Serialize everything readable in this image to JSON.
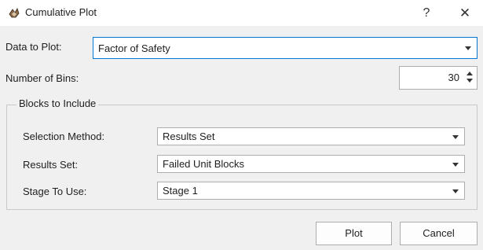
{
  "window": {
    "title": "Cumulative Plot",
    "help_label": "?",
    "close_label": "✕"
  },
  "data_to_plot": {
    "label": "Data to Plot:",
    "value": "Factor of Safety"
  },
  "number_of_bins": {
    "label": "Number of Bins:",
    "value": "30"
  },
  "blocks_group": {
    "title": "Blocks to Include",
    "selection_method": {
      "label": "Selection Method:",
      "value": "Results Set"
    },
    "results_set": {
      "label": "Results Set:",
      "value": "Failed Unit Blocks"
    },
    "stage_to_use": {
      "label": "Stage To Use:",
      "value": "Stage 1"
    }
  },
  "buttons": {
    "plot": "Plot",
    "cancel": "Cancel"
  },
  "colors": {
    "focus_border": "#0078d7",
    "background": "#f0f0f0"
  }
}
